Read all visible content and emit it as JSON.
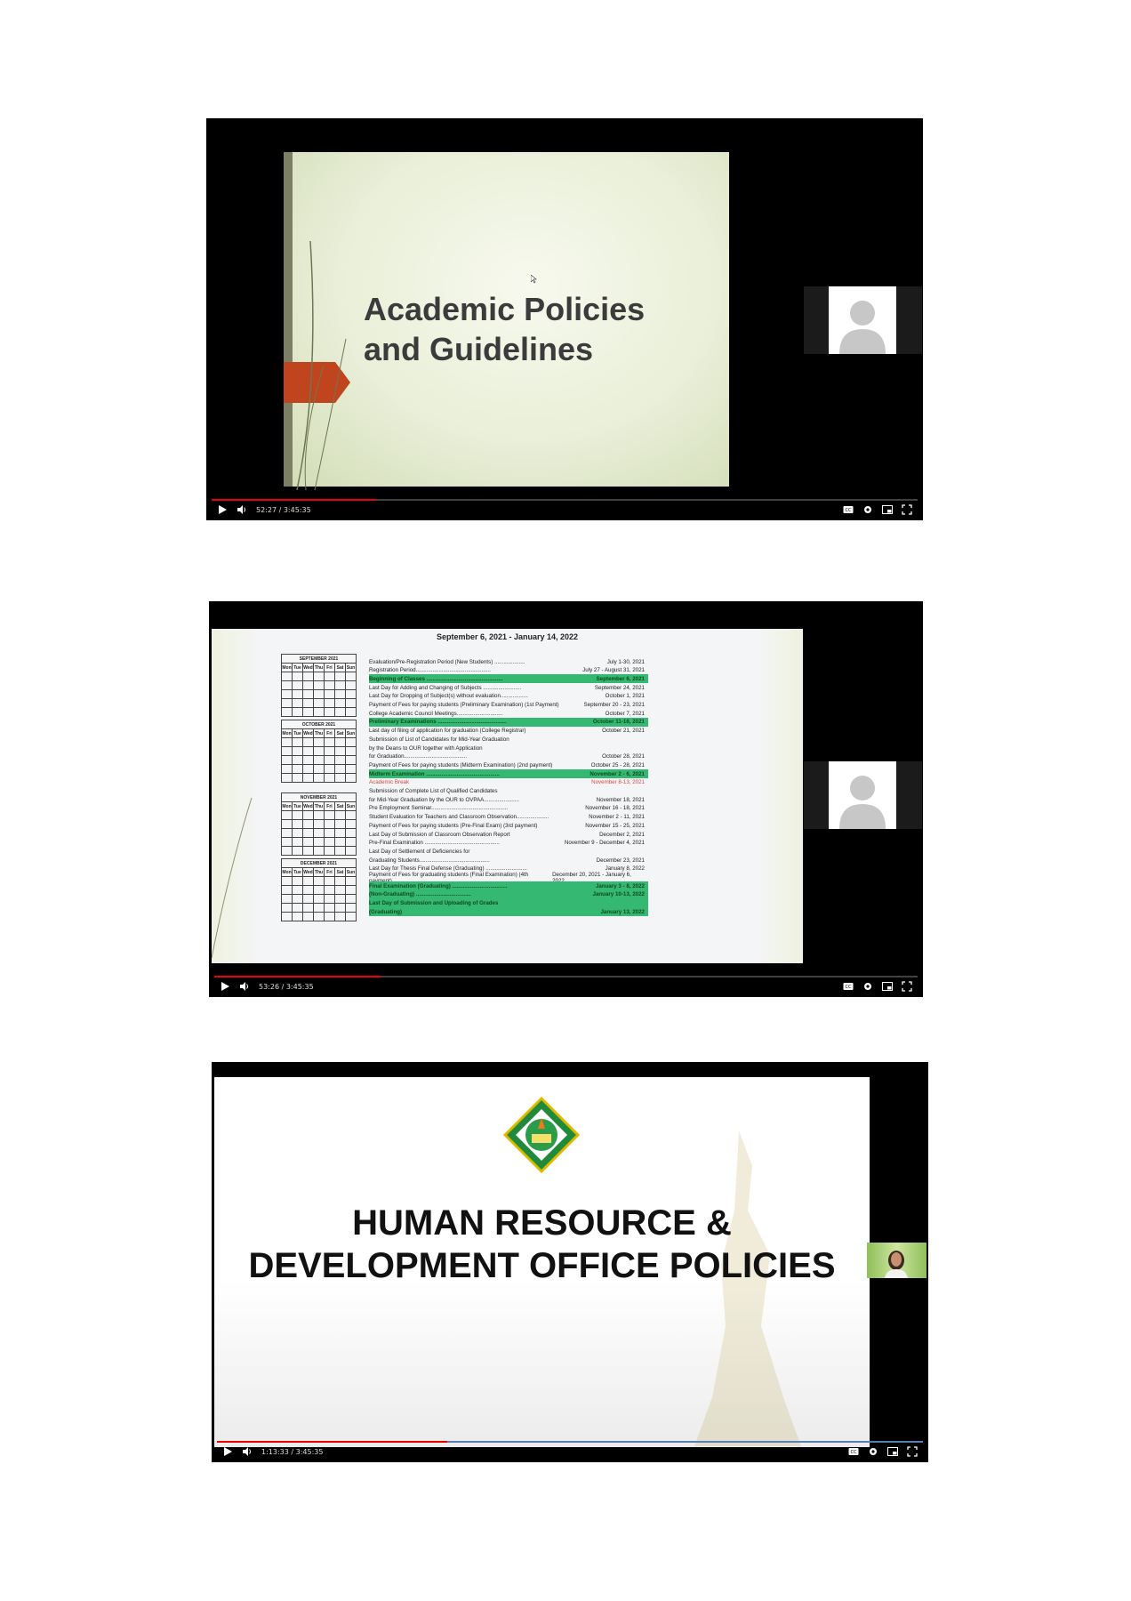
{
  "players": [
    {
      "time": "52:27 / 3:45:35",
      "progress": 0.233,
      "slide": {
        "title": "Academic Policies\nand Guidelines"
      }
    },
    {
      "time": "53:26 / 3:45:35",
      "progress": 0.237,
      "slide": {
        "header": "September 6, 2021 - January 14, 2022",
        "months": [
          {
            "name": "SEPTEMBER 2021",
            "days": [
              "Mon",
              "Tue",
              "Wed",
              "Thu",
              "Fri",
              "Sat",
              "Sun"
            ]
          },
          {
            "name": "OCTOBER 2021",
            "days": [
              "Mon",
              "Tue",
              "Wed",
              "Thu",
              "Fri",
              "Sat",
              "Sun"
            ]
          },
          {
            "name": "NOVEMBER 2021",
            "days": [
              "Mon",
              "Tue",
              "Wed",
              "Thu",
              "Fri",
              "Sat",
              "Sun"
            ]
          },
          {
            "name": "DECEMBER 2021",
            "days": [
              "Mon",
              "Tue",
              "Wed",
              "Thu",
              "Fri",
              "Sat",
              "Sun"
            ]
          }
        ],
        "events": [
          {
            "text": "Evaluation/Pre-Registration Period (New Students) ....................",
            "date": "July 1-30, 2021",
            "style": ""
          },
          {
            "text": "Registration Period.................................................",
            "date": "July 27 - August 31, 2021",
            "style": ""
          },
          {
            "text": "Beginning of Classes ..................................................",
            "date": "September 6, 2021",
            "style": "green"
          },
          {
            "text": "Last Day for Adding and Changing of Subjects .........................",
            "date": "September 24, 2021",
            "style": ""
          },
          {
            "text": "Last Day for Dropping of Subject(s) without evaluation..................",
            "date": "October 1, 2021",
            "style": ""
          },
          {
            "text": "Payment of Fees for paying students (Preliminary Examination) (1st Payment)",
            "date": "September 20 - 23, 2021",
            "style": ""
          },
          {
            "text": "College Academic Council Meetings..............................",
            "date": "October 7, 2021",
            "style": ""
          },
          {
            "text": "Preliminary Examinations .............................................",
            "date": "October 11-16, 2021",
            "style": "green"
          },
          {
            "text": "Last day of filing of application for graduation (College Registrar)",
            "date": "October 21, 2021",
            "style": ""
          },
          {
            "text": "Submission of List of Candidates for Mid-Year Graduation",
            "date": "",
            "style": ""
          },
          {
            "text": "        by the Deans to OUR together with Application",
            "date": "",
            "style": ""
          },
          {
            "text": "        for Graduation.........................................",
            "date": "October 28, 2021",
            "style": ""
          },
          {
            "text": "Payment of Fees for paying students (Midterm Examination) (2nd payment)",
            "date": "October 25 - 28, 2021",
            "style": ""
          },
          {
            "text": "Midterm Examination ................................................",
            "date": "November 2 - 6, 2021",
            "style": "green"
          },
          {
            "text": "Academic Break",
            "date": "November 8-13, 2021",
            "style": "red"
          },
          {
            "text": "Submission of Complete List of Qualified Candidates",
            "date": "",
            "style": ""
          },
          {
            "text": "      for Mid-Year Graduation by the OUR to OVPAA.......................",
            "date": "November 18, 2021",
            "style": ""
          },
          {
            "text": "Pre Employment Seminar..................................................",
            "date": "November 16 - 18, 2021",
            "style": ""
          },
          {
            "text": "Student Evaluation for Teachers and Classroom Observation.....................",
            "date": "November 2 - 11, 2021",
            "style": ""
          },
          {
            "text": "Payment of Fees for paying students (Pre-Final Exam) (3rd payment)",
            "date": "November 15 - 25, 2021",
            "style": ""
          },
          {
            "text": "Last Day of Submission of Classroom Observation Report",
            "date": "December 2, 2021",
            "style": ""
          },
          {
            "text": "Pre-Final Examination .................................................",
            "date": "November 9 - December 4, 2021",
            "style": ""
          },
          {
            "text": "Last Day of Settlement of Deficiencies for",
            "date": "",
            "style": ""
          },
          {
            "text": "      Graduating Students..............................................",
            "date": "December 23, 2021",
            "style": ""
          },
          {
            "text": "Last Day for Thesis Final Defense (Graduating) ...........................",
            "date": "January 8, 2022",
            "style": ""
          },
          {
            "text": "Payment of Fees for graduating students (Final Examination) (4th payment)",
            "date": "December 20, 2021 - January 6, 2022",
            "style": ""
          },
          {
            "text": "Final Examination (Graduating) ....................................",
            "date": "January 3 - 8, 2022",
            "style": "green"
          },
          {
            "text": "            (Non-Graduating) ....................................",
            "date": "January 10-13, 2022",
            "style": "green"
          },
          {
            "text": "Last Day of Submission and Uploading of Grades",
            "date": "",
            "style": "green"
          },
          {
            "text": "            (Graduating)",
            "date": "January 13, 2022",
            "style": "green"
          }
        ]
      }
    },
    {
      "time": "1:13:33 / 3:45:35",
      "progress": 0.326,
      "slide": {
        "title": "HUMAN RESOURCE &\nDEVELOPMENT OFFICE POLICIES"
      }
    }
  ],
  "icons": {
    "play": "play-icon",
    "volume": "volume-icon",
    "captions": "captions-icon",
    "settings": "gear-icon",
    "miniplayer": "miniplayer-icon",
    "fullscreen": "fullscreen-icon"
  },
  "colors": {
    "progress": "#e00000",
    "highlight": "#35b871",
    "slide_arrow": "#c0451f"
  }
}
